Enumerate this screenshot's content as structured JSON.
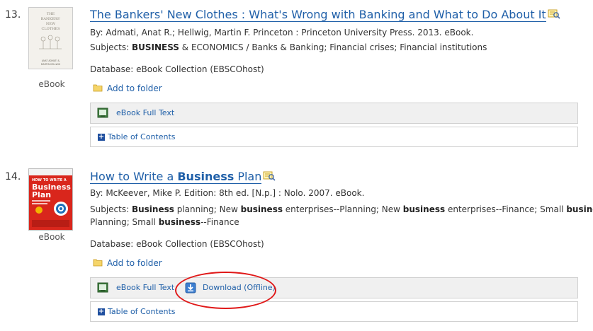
{
  "results": [
    {
      "number": "13.",
      "title_plain": "The Bankers' New Clothes : What's Wrong with Banking and What to Do About It",
      "byline": "By: Admati, Anat R.; Hellwig, Martin F. Princeton : Princeton University Press. 2013. eBook.",
      "subjects_label": "Subjects: ",
      "subjects_bold": "BUSINESS",
      "subjects_rest": " & ECONOMICS / Banks & Banking; Financial crises; Financial institutions",
      "database": "Database: eBook Collection (EBSCOhost)",
      "add_folder": "Add to folder",
      "fulltext": "eBook Full Text",
      "toc": "Table of Contents",
      "type": "eBook",
      "cover": {
        "title_lines": [
          "THE",
          "BANKERS'",
          "NEW",
          "CLOTHES"
        ],
        "authors": [
          "ANAT ADMATI &",
          "MARTIN HELLWIG"
        ]
      }
    },
    {
      "number": "14.",
      "title_pre": "How to Write a ",
      "title_bold": "Business",
      "title_post": " Plan",
      "byline": "By: McKeever, Mike P. Edition: 8th ed. [N.p.] : Nolo. 2007. eBook.",
      "subjects_line1": {
        "s1": "Subjects: ",
        "b1": "Business",
        "s2": " planning; New ",
        "b2": "business",
        "s3": " enterprises--Planning; New ",
        "b3": "business",
        "s4": " enterprises--Finance; Small ",
        "b4": "business",
        "s5": "--"
      },
      "subjects_line2": {
        "s1": "Planning; Small ",
        "b1": "business",
        "s2": "--Finance"
      },
      "database": "Database: eBook Collection (EBSCOhost)",
      "add_folder": "Add to folder",
      "fulltext": "eBook Full Text",
      "download": "Download (Offline)",
      "toc": "Table of Contents",
      "type": "eBook",
      "cover": {
        "lines": [
          "HOW TO WRITE A",
          "Business",
          "Plan"
        ]
      }
    }
  ],
  "colors": {
    "link": "#1f5fa8",
    "highlight": "#e01818",
    "bar": "#f0f0f0"
  }
}
